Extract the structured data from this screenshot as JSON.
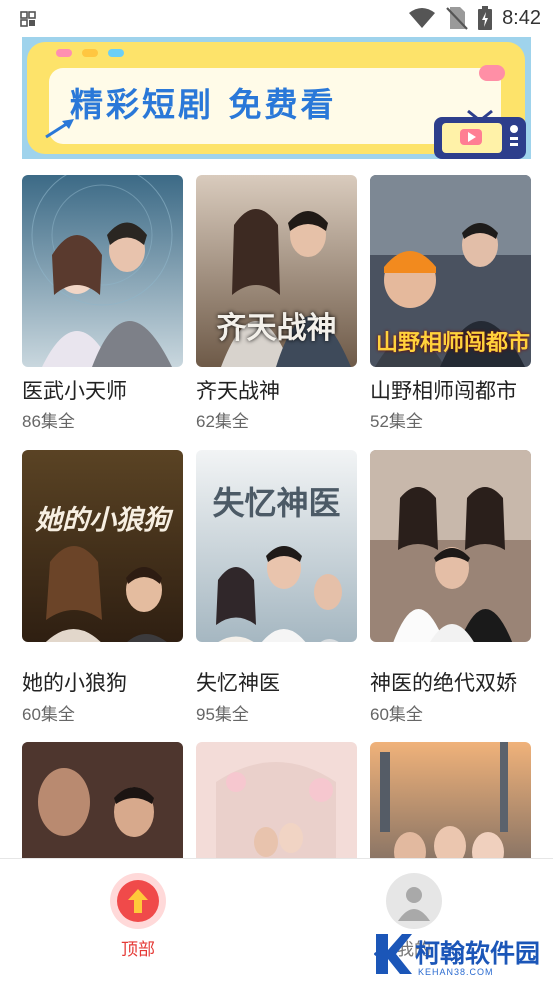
{
  "status_bar": {
    "time": "8:42",
    "icons": [
      "apps-grid-icon",
      "wifi-icon",
      "no-sim-icon",
      "battery-charging-icon"
    ]
  },
  "banner": {
    "title": "精彩短剧 免费看",
    "colors": {
      "background": "#9fd3ec",
      "panel": "#fde36a",
      "title": "#2a78d8"
    }
  },
  "dramas": [
    {
      "title": "医武小天师",
      "episodes": "86集全",
      "poster_text": ""
    },
    {
      "title": "齐天战神",
      "episodes": "62集全",
      "poster_text": "齐天战神"
    },
    {
      "title": "山野相师闯都市",
      "episodes": "52集全",
      "poster_text": "山野相师闯都市"
    },
    {
      "title": "她的小狼狗",
      "episodes": "60集全",
      "poster_text": "她的小狼狗"
    },
    {
      "title": "失忆神医",
      "episodes": "95集全",
      "poster_text": "失忆神医"
    },
    {
      "title": "神医的绝代双娇",
      "episodes": "60集全",
      "poster_text": ""
    },
    {
      "title": "",
      "episodes": "",
      "poster_text": ""
    },
    {
      "title": "",
      "episodes": "",
      "poster_text": ""
    },
    {
      "title": "",
      "episodes": "",
      "poster_text": ""
    }
  ],
  "tab_bar": {
    "top_label": "顶部",
    "me_label": "我的",
    "accent_color": "#e53935"
  },
  "watermark": {
    "text": "柯翰软件园",
    "sub": "KEHAN38.COM"
  }
}
